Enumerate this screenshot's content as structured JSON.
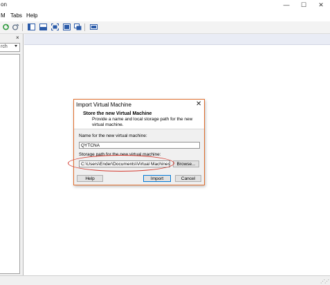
{
  "window": {
    "title_fragment": "on"
  },
  "menubar": {
    "items": [
      "M",
      "Tabs",
      "Help"
    ]
  },
  "toolbar": {
    "icons": [
      "refresh-icon",
      "discard-icon",
      "details-icon",
      "snapshots-icon",
      "fullscreen-icon",
      "seamless-icon",
      "clone-icon",
      "preview-icon"
    ]
  },
  "sidebar": {
    "search_text": "rch",
    "close_glyph": "×"
  },
  "dialog": {
    "title": "Import Virtual Machine",
    "header_title": "Store the new Virtual Machine",
    "header_description": "Provide a name and local storage path for the new virtual machine.",
    "name_label": "Name for the new virtual machine:",
    "name_value": "QYTCNA",
    "path_label": "Storage path for the new virtual machine:",
    "path_value": "C:\\Users\\Ender\\Documents\\Virtual Machines\\QYT",
    "browse_label": "Browse...",
    "help_label": "Help",
    "import_label": "Import",
    "cancel_label": "Cancel"
  },
  "colors": {
    "annotation": "#d43a2f",
    "dialog_border": "#e06d2c",
    "header_band": "#e9ecf5"
  }
}
